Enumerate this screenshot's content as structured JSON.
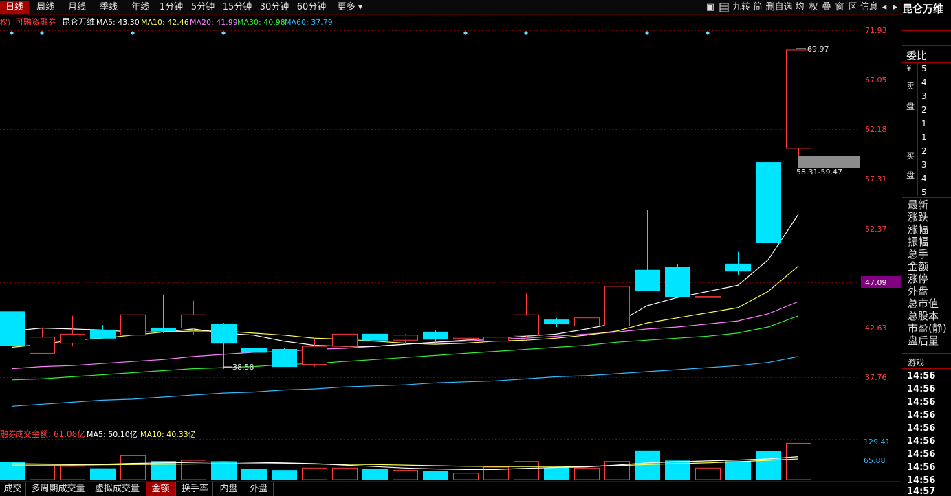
{
  "top_tabs": [
    {
      "label": "日线",
      "active": true
    },
    {
      "label": "周线"
    },
    {
      "label": "月线"
    },
    {
      "label": "季线"
    },
    {
      "label": "年线"
    },
    {
      "label": "1分钟"
    },
    {
      "label": "5分钟"
    },
    {
      "label": "15分钟"
    },
    {
      "label": "30分钟"
    },
    {
      "label": "60分钟"
    },
    {
      "label": "更多 ▾"
    }
  ],
  "toolbar": [
    "▣",
    "九转",
    "简",
    "删自选",
    "均",
    "权",
    "叠",
    "窗",
    "区",
    "信息",
    "◂",
    "▸"
  ],
  "stock_name": "昆仑万维",
  "main_legend": {
    "prefix": "权)",
    "tag": "可融资融券",
    "name": "昆仑万维",
    "ma5": "MA5: 43.30",
    "ma10": "MA10: 42.46",
    "ma20": "MA20: 41.99",
    "ma30": "MA30: 40.98",
    "ma60": "MA60: 37.79"
  },
  "price_axis": [
    "71.93",
    "67.05",
    "62.18",
    "57.31",
    "52.37",
    "47.09",
    "42.63",
    "37.76"
  ],
  "current_price_tag": "47.09",
  "annotations": {
    "high": "69.97",
    "low": "38.58",
    "gap": "58.31-59.47"
  },
  "volume_legend": {
    "tag": "融券",
    "label": "成交金额: 61.08亿",
    "ma5": "MA5: 50.10亿",
    "ma10": "MA10: 40.33亿"
  },
  "volume_axis": [
    "129.41",
    "65.88"
  ],
  "bottom_tabs": [
    {
      "label": "成交量"
    },
    {
      "label": "多周期成交量"
    },
    {
      "label": "虚拟成交量"
    },
    {
      "label": "金额",
      "active": true
    },
    {
      "label": "换手率"
    },
    {
      "label": "内盘"
    },
    {
      "label": "外盘"
    }
  ],
  "right_panel": {
    "weibi": "委比",
    "currency": "¥",
    "sell_label": [
      "卖",
      "盘"
    ],
    "sell_levels": [
      "5",
      "4",
      "3",
      "2",
      "1"
    ],
    "buy_label": [
      "买",
      "盘"
    ],
    "buy_levels": [
      "1",
      "2",
      "3",
      "4",
      "5"
    ],
    "stats": [
      "最新",
      "涨跌",
      "涨幅",
      "振幅",
      "总手",
      "金额",
      "涨停",
      "外盘",
      "总市值",
      "总股本",
      "市盈(静)",
      "盘后量"
    ],
    "trades_header": "游戏",
    "times": [
      "14:56",
      "14:56",
      "14:56",
      "14:56",
      "14:56",
      "14:56",
      "14:56",
      "14:56",
      "14:56",
      "14:57"
    ]
  },
  "colors": {
    "up": "#ff3c3c",
    "down": "#00e5ff",
    "ma5": "#ffffff",
    "ma10": "#ffff55",
    "ma20": "#ff80ff",
    "ma30": "#33ee33",
    "ma60": "#33bbff",
    "grid": "#7a0000",
    "axis_text": "#ff4040",
    "price_tag_bg": "#800080"
  },
  "chart_data": {
    "type": "candlestick",
    "price_ylim": [
      35.0,
      74.0
    ],
    "candles": [
      {
        "o": 44.2,
        "h": 44.5,
        "l": 40.9,
        "c": 40.9
      },
      {
        "o": 40.1,
        "h": 42.6,
        "l": 40.0,
        "c": 41.7
      },
      {
        "o": 41.1,
        "h": 43.8,
        "l": 40.8,
        "c": 42.0
      },
      {
        "o": 42.4,
        "h": 42.9,
        "l": 41.6,
        "c": 41.6
      },
      {
        "o": 41.9,
        "h": 47.0,
        "l": 41.8,
        "c": 43.9
      },
      {
        "o": 42.6,
        "h": 45.9,
        "l": 42.1,
        "c": 42.3
      },
      {
        "o": 42.6,
        "h": 45.3,
        "l": 41.9,
        "c": 43.9
      },
      {
        "o": 43.0,
        "h": 43.1,
        "l": 38.58,
        "c": 41.1
      },
      {
        "o": 40.6,
        "h": 41.2,
        "l": 39.9,
        "c": 40.2
      },
      {
        "o": 40.5,
        "h": 40.6,
        "l": 38.8,
        "c": 38.8
      },
      {
        "o": 39.0,
        "h": 41.5,
        "l": 38.8,
        "c": 40.8
      },
      {
        "o": 40.8,
        "h": 43.1,
        "l": 39.6,
        "c": 42.0
      },
      {
        "o": 42.0,
        "h": 42.9,
        "l": 41.4,
        "c": 41.4
      },
      {
        "o": 41.4,
        "h": 42.0,
        "l": 41.0,
        "c": 41.9
      },
      {
        "o": 42.2,
        "h": 42.4,
        "l": 41.0,
        "c": 41.5
      },
      {
        "o": 41.5,
        "h": 41.8,
        "l": 41.0,
        "c": 41.6
      },
      {
        "o": 41.3,
        "h": 43.6,
        "l": 41.0,
        "c": 41.7
      },
      {
        "o": 41.9,
        "h": 46.0,
        "l": 41.6,
        "c": 43.9
      },
      {
        "o": 43.4,
        "h": 43.6,
        "l": 42.7,
        "c": 43.0
      },
      {
        "o": 42.8,
        "h": 44.1,
        "l": 42.7,
        "c": 43.6
      },
      {
        "o": 42.8,
        "h": 47.7,
        "l": 42.6,
        "c": 46.7
      },
      {
        "o": 48.3,
        "h": 54.2,
        "l": 47.4,
        "c": 46.3
      },
      {
        "o": 48.6,
        "h": 48.9,
        "l": 45.7,
        "c": 45.7
      },
      {
        "o": 45.6,
        "h": 46.8,
        "l": 44.8,
        "c": 45.7
      },
      {
        "o": 48.9,
        "h": 50.1,
        "l": 47.8,
        "c": 48.2
      },
      {
        "o": 58.9,
        "h": 58.9,
        "l": 51.0,
        "c": 51.0
      },
      {
        "o": 60.3,
        "h": 69.97,
        "l": 58.9,
        "c": 69.97
      }
    ],
    "ma5": [
      42.3,
      42.6,
      42.5,
      42.4,
      42.2,
      42.2,
      42.5,
      42.1,
      41.9,
      41.3,
      40.9,
      40.8,
      40.8,
      41.0,
      41.2,
      41.4,
      41.6,
      41.8,
      42.0,
      42.5,
      43.1,
      44.8,
      45.6,
      46.2,
      46.8,
      49.3,
      53.8
    ],
    "ma10": [
      40.7,
      41.0,
      41.4,
      41.6,
      41.9,
      42.2,
      42.3,
      42.3,
      42.1,
      41.9,
      41.6,
      41.5,
      41.3,
      41.1,
      41.0,
      41.1,
      41.3,
      41.4,
      41.6,
      41.9,
      42.3,
      43.1,
      43.6,
      44.1,
      44.6,
      46.2,
      48.7
    ],
    "ma20": [
      38.6,
      38.8,
      38.9,
      39.1,
      39.3,
      39.5,
      39.8,
      40.0,
      40.2,
      40.3,
      40.5,
      40.6,
      40.8,
      41.0,
      41.2,
      41.3,
      41.5,
      41.6,
      41.8,
      42.0,
      42.2,
      42.5,
      42.7,
      43.0,
      43.3,
      44.0,
      45.2
    ],
    "ma30": [
      37.5,
      37.6,
      37.8,
      38.0,
      38.2,
      38.4,
      38.6,
      38.7,
      38.8,
      39.0,
      39.1,
      39.3,
      39.5,
      39.7,
      39.9,
      40.1,
      40.3,
      40.5,
      40.7,
      40.9,
      41.2,
      41.4,
      41.6,
      41.8,
      42.1,
      42.7,
      43.8
    ],
    "ma60": [
      34.9,
      35.1,
      35.3,
      35.5,
      35.6,
      35.8,
      36.0,
      36.2,
      36.3,
      36.5,
      36.6,
      36.8,
      36.9,
      37.0,
      37.2,
      37.3,
      37.4,
      37.6,
      37.8,
      37.9,
      38.1,
      38.3,
      38.5,
      38.7,
      38.9,
      39.2,
      39.8
    ],
    "volume_ylim": [
      0,
      140
    ],
    "amount": [
      60,
      47,
      46,
      38,
      83,
      63,
      67,
      62,
      36,
      32,
      40,
      40,
      35,
      32,
      29,
      22,
      43,
      63,
      40,
      40,
      63,
      100,
      65,
      40,
      63,
      99,
      126
    ],
    "amount_ma5": [
      55,
      54,
      53,
      53,
      56,
      58,
      60,
      62,
      60,
      58,
      55,
      50,
      45,
      40,
      37,
      35,
      35,
      39,
      42,
      44,
      50,
      58,
      62,
      65,
      68,
      72,
      80
    ],
    "amount_ma10": [
      50,
      50,
      50,
      51,
      52,
      53,
      54,
      55,
      55,
      55,
      54,
      53,
      52,
      50,
      48,
      46,
      45,
      45,
      45,
      46,
      48,
      52,
      55,
      58,
      62,
      67,
      72
    ]
  }
}
